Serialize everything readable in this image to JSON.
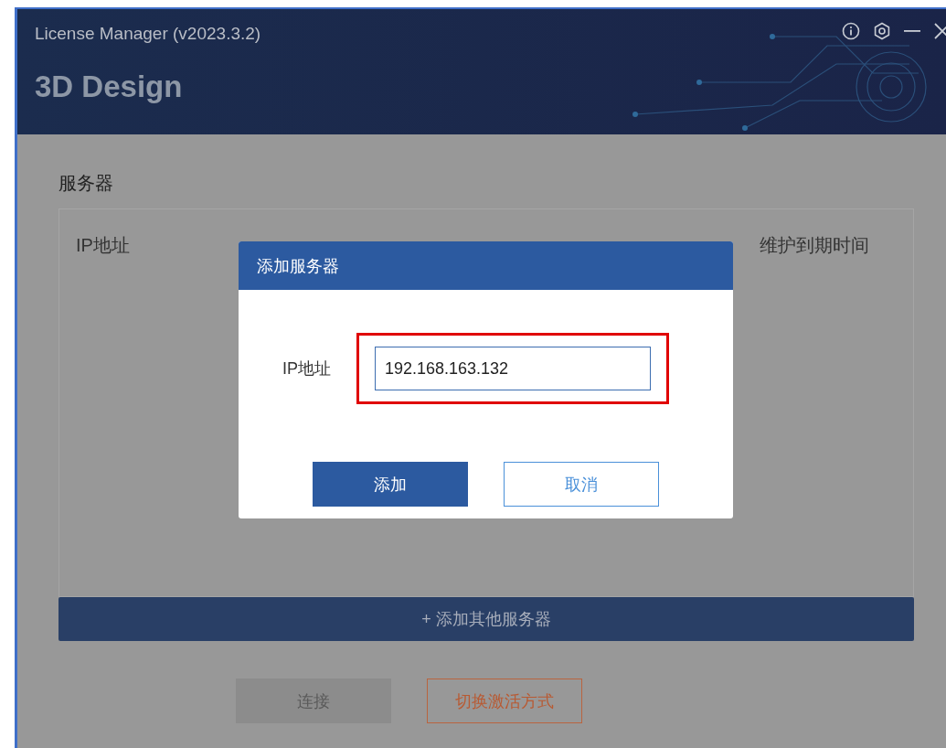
{
  "window": {
    "title": "License Manager (v2023.3.2)",
    "product": "3D Design"
  },
  "server_section": {
    "heading": "服务器",
    "table": {
      "columns": [
        {
          "label": "IP地址"
        },
        {
          "label": "维护到期时间"
        }
      ]
    },
    "add_other_button": "+ 添加其他服务器"
  },
  "buttons": [
    {
      "label": "连接",
      "kind": "primary",
      "disabled": true
    },
    {
      "label": "切换激活方式",
      "kind": "outline",
      "disabled": false
    }
  ],
  "dialog": {
    "title": "添加服务器",
    "field_label": "IP地址",
    "value": "192.168.163.132",
    "highlighted": true,
    "buttons": [
      {
        "label": "添加",
        "kind": "primary"
      },
      {
        "label": "取消",
        "kind": "secondary"
      }
    ]
  }
}
